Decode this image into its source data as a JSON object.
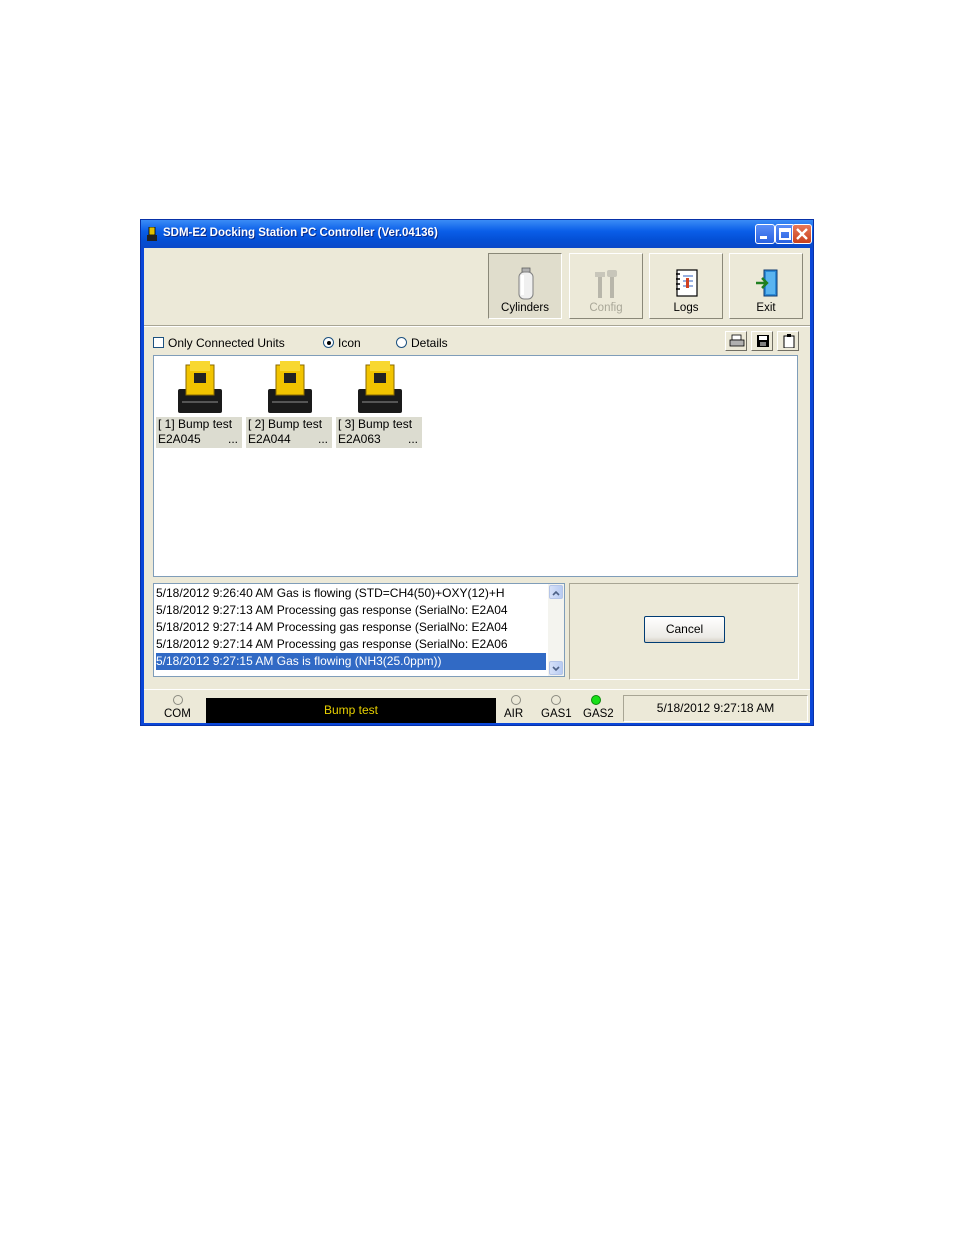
{
  "window": {
    "title": "SDM-E2 Docking Station PC Controller (Ver.04136)"
  },
  "toolbar": {
    "cylinders_label": "Cylinders",
    "config_label": "Config",
    "logs_label": "Logs",
    "exit_label": "Exit"
  },
  "options": {
    "only_connected_label": "Only Connected Units",
    "only_connected_checked": false,
    "view_icon_label": "Icon",
    "view_details_label": "Details",
    "selected_view": "Icon"
  },
  "units": [
    {
      "line1": "[ 1] Bump test",
      "serial": "E2A045",
      "more": "..."
    },
    {
      "line1": "[ 2] Bump test",
      "serial": "E2A044",
      "more": "..."
    },
    {
      "line1": "[ 3] Bump test",
      "serial": "E2A063",
      "more": "..."
    }
  ],
  "log": [
    "5/18/2012 9:26:40 AM Gas is flowing (STD=CH4(50)+OXY(12)+H",
    "5/18/2012 9:27:13 AM Processing gas response (SerialNo: E2A04",
    "5/18/2012 9:27:14 AM Processing gas response (SerialNo: E2A04",
    "5/18/2012 9:27:14 AM Processing gas response (SerialNo: E2A06",
    "5/18/2012 9:27:15 AM Gas is flowing (NH3(25.0ppm))"
  ],
  "cancel_label": "Cancel",
  "status": {
    "com_label": "COM",
    "com_on": false,
    "lcd_text": "Bump test",
    "air_label": "AIR",
    "air_on": false,
    "gas1_label": "GAS1",
    "gas1_on": false,
    "gas2_label": "GAS2",
    "gas2_on": true,
    "datetime": "5/18/2012 9:27:18 AM"
  },
  "colors": {
    "titlebar": "#0a5ee8",
    "selection": "#316ac5",
    "lcd_text": "#e8d000",
    "led_on": "#18e018"
  }
}
